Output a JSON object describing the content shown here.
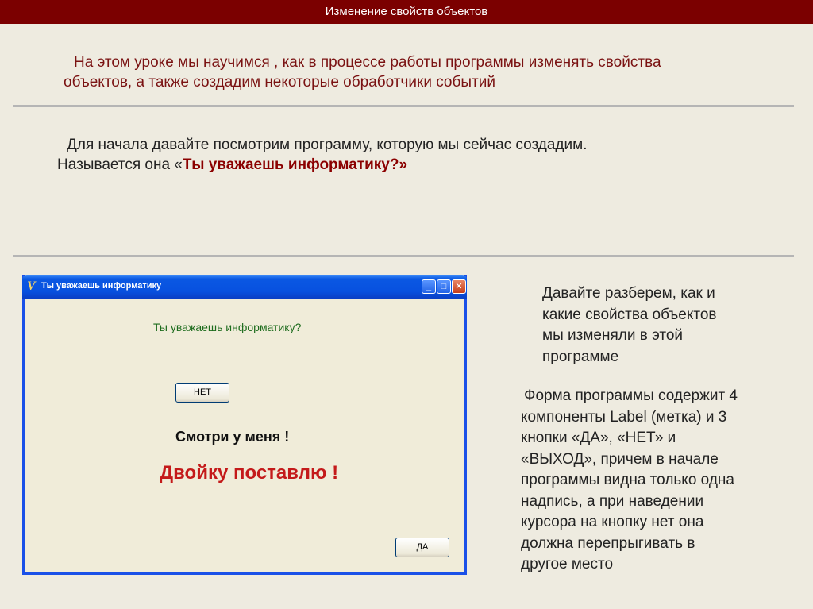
{
  "header": {
    "title": "Изменение свойств объектов"
  },
  "intro": {
    "line1": "На этом уроке мы научимся , как в процессе работы программы изменять свойства",
    "line2": "объектов, а также создадим некоторые обработчики событий"
  },
  "lead": {
    "line1": "Для начала давайте посмотрим программу, которую мы сейчас создадим.",
    "line2_prefix": "Называется она «",
    "program_name": "Ты уважаешь информатику?»"
  },
  "window": {
    "title": "Ты уважаешь информатику",
    "app_icon_glyph": "V",
    "controls": {
      "minimize": "_",
      "maximize": "□",
      "close": "✕"
    },
    "question_label": "Ты уважаешь информатику?",
    "no_button": "НЕТ",
    "see_label": "Смотри у меня !",
    "grade_label": "Двойку поставлю !",
    "yes_button": "ДА"
  },
  "side_note": {
    "lines": [
      "Давайте разберем, как и",
      "какие свойства объектов",
      "мы изменяли в этой",
      "программе"
    ]
  },
  "description": {
    "lines": [
      "Форма программы содержит 4",
      "компоненты Label (метка) и 3",
      "кнопки  «ДА», «НЕТ» и",
      "«ВЫХОД», причем в начале",
      "программы видна только одна",
      "надпись, а при наведении",
      "курсора на кнопку нет она",
      "должна перепрыгивать в",
      "другое место"
    ]
  },
  "colors": {
    "header_bg": "#7b0000",
    "accent_red": "#8b0000",
    "page_bg": "#eeebe0",
    "xp_blue": "#0851df"
  }
}
